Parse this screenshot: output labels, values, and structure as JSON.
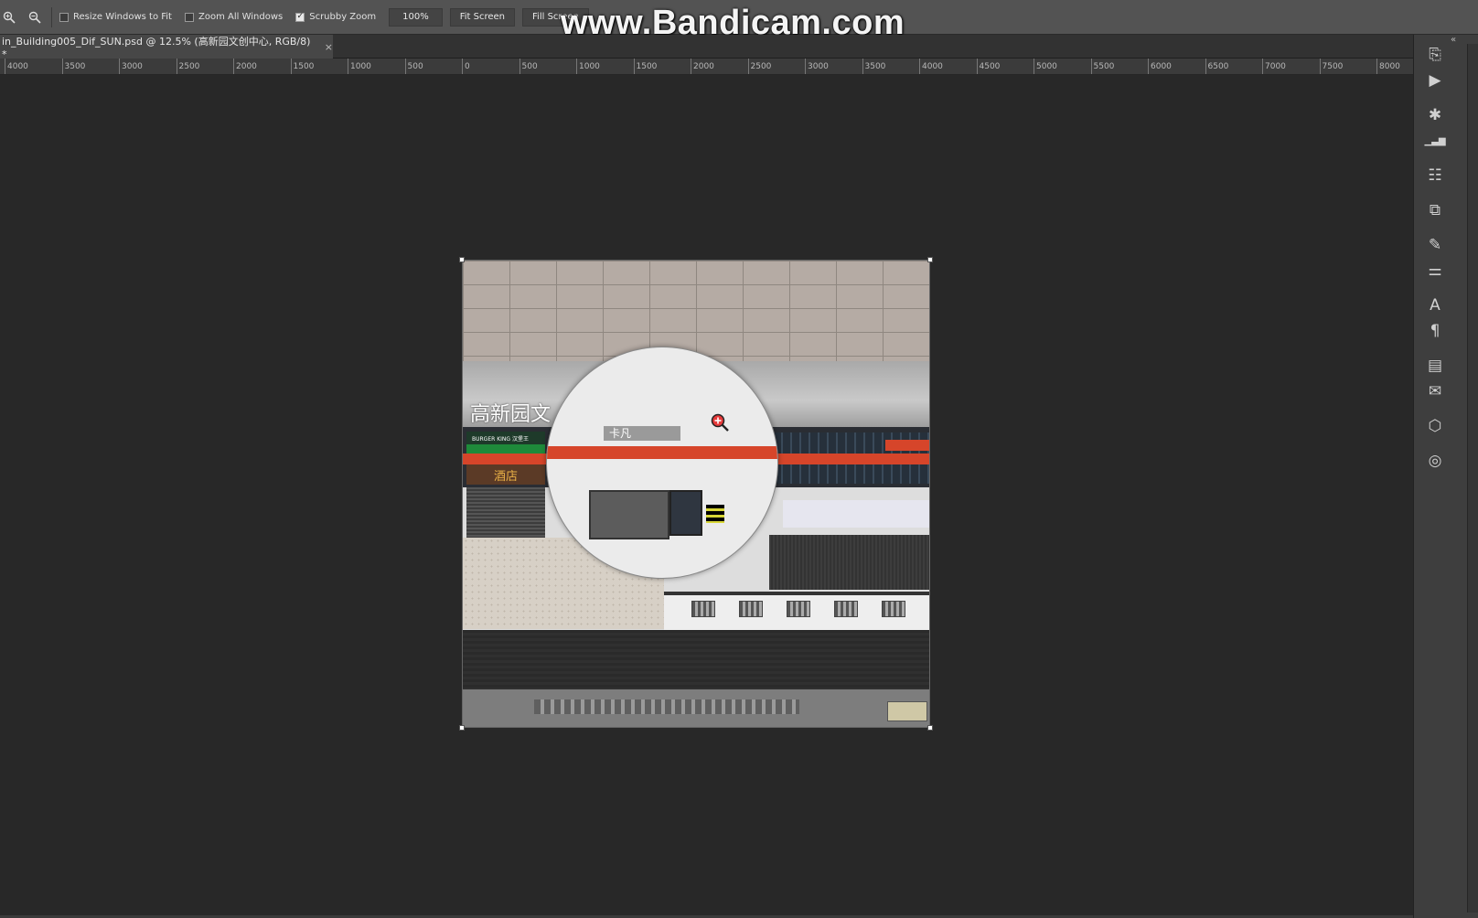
{
  "options_bar": {
    "resize_windows_label": "Resize Windows to Fit",
    "resize_windows_checked": false,
    "zoom_all_label": "Zoom All Windows",
    "zoom_all_checked": false,
    "scrubby_zoom_label": "Scrubby Zoom",
    "scrubby_zoom_checked": true,
    "zoom_100_label": "100%",
    "fit_screen_label": "Fit Screen",
    "fill_screen_label": "Fill Screen"
  },
  "watermark": "www.Bandicam.com",
  "document_tab": {
    "title": "in_Building005_Dif_SUN.psd @ 12.5% (高新园文创中心, RGB/8) *",
    "close_glyph": "×"
  },
  "ruler_labels": [
    "4000",
    "3500",
    "3000",
    "2500",
    "2000",
    "1500",
    "1000",
    "500",
    "0",
    "500",
    "1000",
    "1500",
    "2000",
    "2500",
    "3000",
    "3500",
    "4000",
    "4500",
    "5000",
    "5500",
    "6000",
    "6500",
    "7000",
    "7500",
    "8000"
  ],
  "texture": {
    "sign_text": "高新园文",
    "burger_text": "BURGER KING 汉堡王",
    "hotel_text": "酒店",
    "card_text": "卡凡"
  },
  "dock_icons": [
    "history-icon",
    "play-action-icon",
    "adjust-icon",
    "histogram-icon",
    "properties-icon",
    "clone-source-icon",
    "brush-presets-icon",
    "brush-settings-icon",
    "character-icon",
    "paragraph-icon",
    "layer-comps-icon",
    "notes-icon",
    "3d-icon",
    "paths-icon"
  ],
  "colors": {
    "accent_red": "#d6452a",
    "panel_bg": "#535353",
    "canvas_bg": "#282828"
  }
}
